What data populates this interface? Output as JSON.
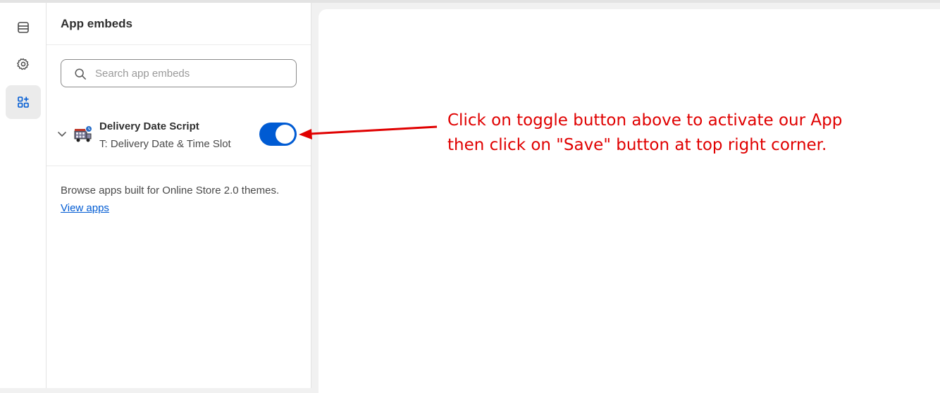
{
  "rail": {
    "items": [
      {
        "icon": "sections-icon",
        "active": false
      },
      {
        "icon": "gear-icon",
        "active": false
      },
      {
        "icon": "app-embeds-icon",
        "active": true
      }
    ]
  },
  "panel": {
    "title": "App embeds",
    "search": {
      "placeholder": "Search app embeds",
      "value": ""
    },
    "embed": {
      "name": "Delivery Date Script",
      "subtitle": "T: Delivery Date & Time Slot",
      "enabled": true
    },
    "browse_text": "Browse apps built for Online Store 2.0 themes.",
    "view_apps_link": "View apps"
  },
  "annotation": {
    "line1": "Click on toggle button above to activate our App",
    "line2": "then click on \"Save\" button at top right corner.",
    "color": "#e00000"
  },
  "colors": {
    "accent": "#005bd3",
    "annotation": "#e00000"
  }
}
